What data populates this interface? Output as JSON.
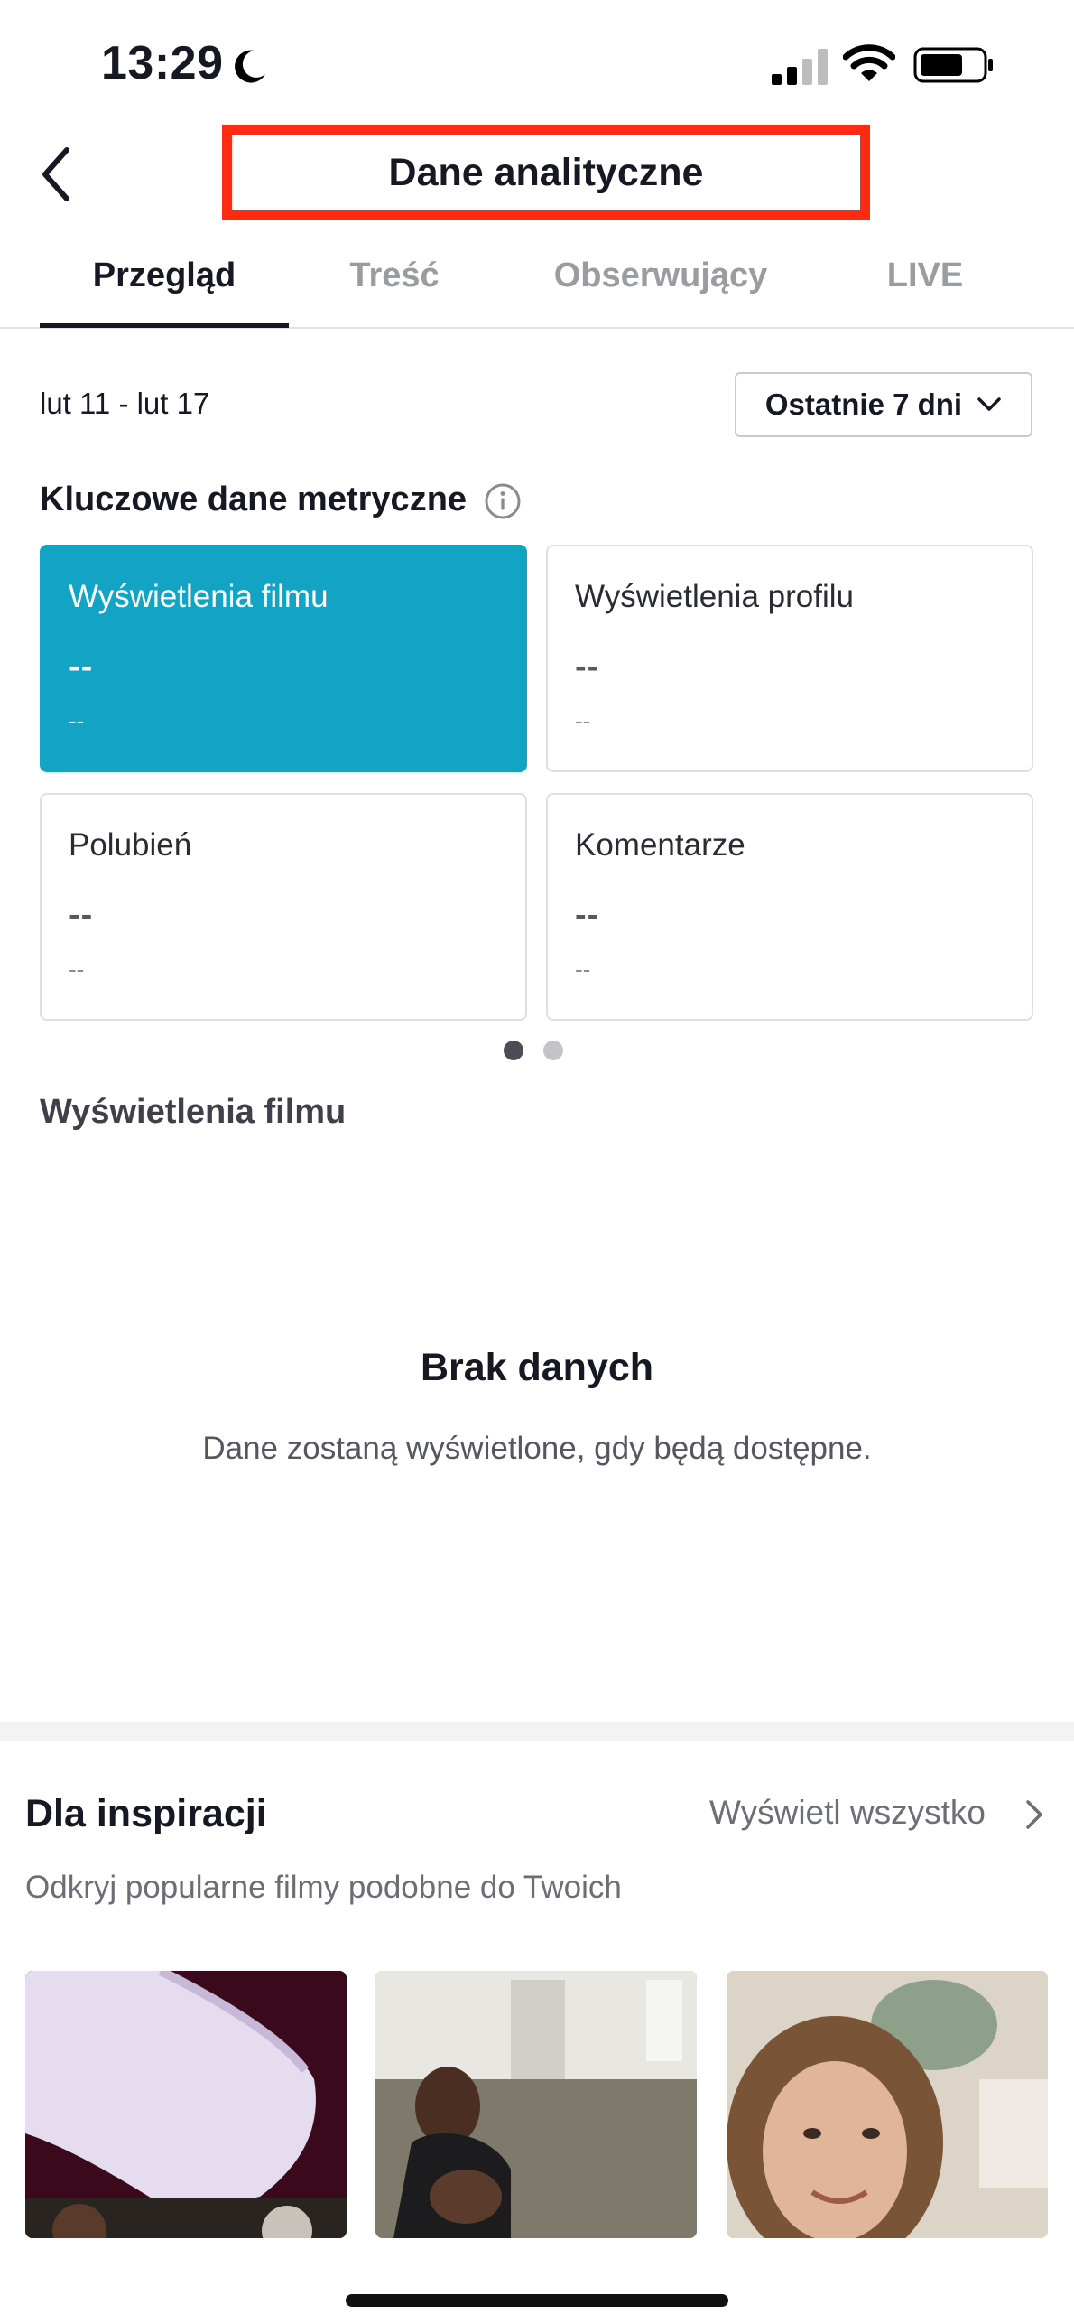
{
  "status_bar": {
    "time": "13:29"
  },
  "header": {
    "title": "Dane analityczne"
  },
  "tabs": [
    {
      "label": "Przegląd",
      "active": true
    },
    {
      "label": "Treść",
      "active": false
    },
    {
      "label": "Obserwujący",
      "active": false
    },
    {
      "label": "LIVE",
      "active": false
    }
  ],
  "date_range": "lut 11 - lut 17",
  "period_selector": {
    "value": "Ostatnie 7 dni"
  },
  "key_metrics": {
    "title": "Kluczowe dane metryczne",
    "cards": [
      {
        "title": "Wyświetlenia filmu",
        "value": "--",
        "change": "--",
        "selected": true
      },
      {
        "title": "Wyświetlenia profilu",
        "value": "--",
        "change": "--",
        "selected": false
      },
      {
        "title": "Polubień",
        "value": "--",
        "change": "--",
        "selected": false
      },
      {
        "title": "Komentarze",
        "value": "--",
        "change": "--",
        "selected": false
      }
    ],
    "pager": {
      "pages": 2,
      "current": 1
    }
  },
  "chart_section": {
    "title": "Wyświetlenia filmu",
    "empty_title": "Brak danych",
    "empty_message": "Dane zostaną wyświetlone, gdy będą dostępne."
  },
  "inspiration": {
    "title": "Dla inspiracji",
    "see_all": "Wyświetl wszystko",
    "subtitle": "Odkryj popularne filmy podobne do Twoich"
  },
  "colors": {
    "accent": "#12a3c5",
    "highlight_box": "#ff2a12",
    "text_primary": "#161823",
    "text_secondary": "#6d6e75"
  },
  "icons": {
    "back": "chevron-left-icon",
    "info": "info-icon",
    "dropdown": "chevron-down-icon",
    "see_all": "chevron-right-icon",
    "moon": "moon-icon",
    "signal": "cellular-signal-icon",
    "wifi": "wifi-icon",
    "battery": "battery-icon"
  }
}
